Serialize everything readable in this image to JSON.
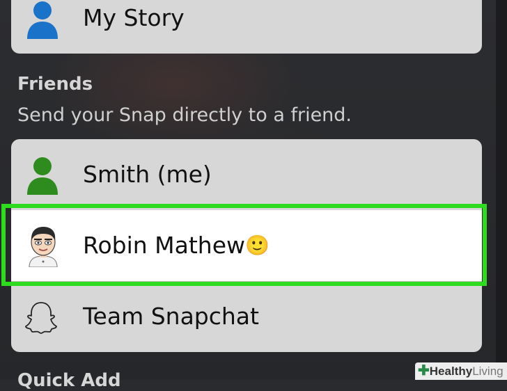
{
  "my_story": {
    "label": "My Story",
    "icon": "person-icon",
    "icon_color": "#1a73c9"
  },
  "friends_section": {
    "title": "Friends",
    "subtitle": "Send your Snap directly to a friend.",
    "items": [
      {
        "label": "Smith (me)",
        "icon": "person-icon",
        "icon_color": "#2e8b1e"
      },
      {
        "label": "Robin Mathew",
        "icon": "bitmoji-avatar",
        "emoji": "🙂",
        "selected": true
      },
      {
        "label": "Team Snapchat",
        "icon": "ghost-icon"
      }
    ]
  },
  "next_section": {
    "title": "Quick Add"
  },
  "highlight_color": "#2edb1e",
  "watermark": {
    "part1": "Healthy",
    "part2": "Living"
  }
}
